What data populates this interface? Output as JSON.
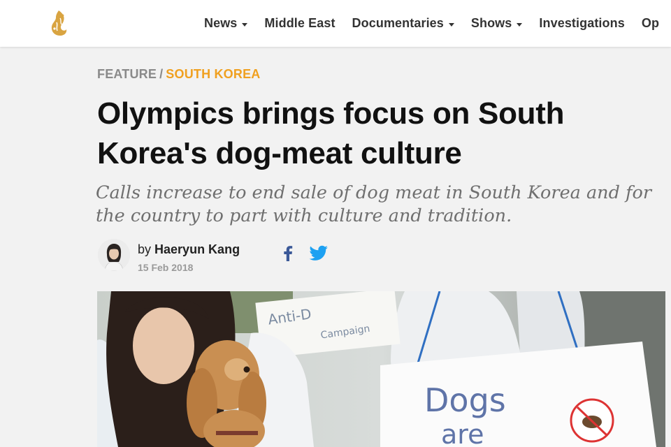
{
  "nav": {
    "items": [
      {
        "label": "News",
        "dropdown": true
      },
      {
        "label": "Middle East",
        "dropdown": false
      },
      {
        "label": "Documentaries",
        "dropdown": true
      },
      {
        "label": "Shows",
        "dropdown": true
      },
      {
        "label": "Investigations",
        "dropdown": false
      },
      {
        "label": "Op",
        "dropdown": false
      }
    ],
    "logo_icon": "al-jazeera-logo-icon"
  },
  "article": {
    "section": "FEATURE",
    "separator": "/",
    "region": "SOUTH KOREA",
    "title": "Olympics brings focus on South Korea's dog-meat culture",
    "dek": "Calls increase to end sale of dog meat in South Korea and for the country to part with culture and tradition.",
    "byline_prefix": "by",
    "author": "Haeryun Kang",
    "date": "15 Feb 2018",
    "share_icons": [
      "facebook-icon",
      "twitter-icon"
    ],
    "hero_sign_top": "Anti-D",
    "hero_sign_top_2": "Campaign",
    "hero_sign_main": "Dogs",
    "hero_sign_main_2": "are"
  },
  "colors": {
    "accent": "#f0a020",
    "logo": "#d9a441",
    "facebook": "#3b5998",
    "twitter": "#1da1f2"
  }
}
